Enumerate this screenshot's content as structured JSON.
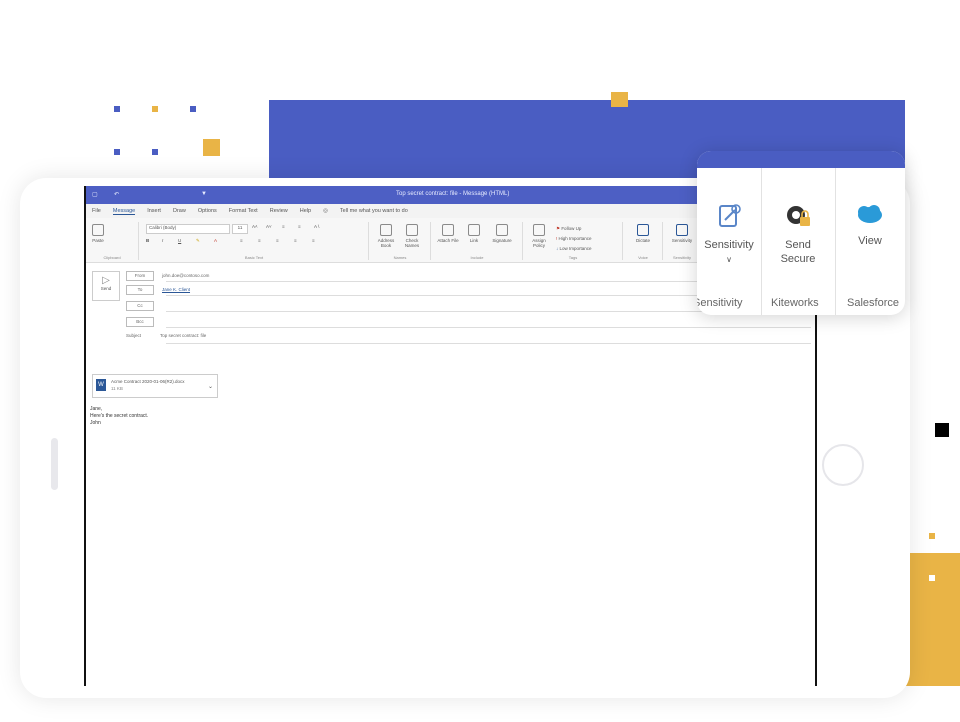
{
  "window": {
    "title": "Top secret contract: file - Message (HTML)",
    "tell_me": "Tell me what you want to do"
  },
  "tabs": [
    "File",
    "Message",
    "Insert",
    "Draw",
    "Options",
    "Format Text",
    "Review",
    "Help"
  ],
  "ribbon": {
    "groups": [
      "Clipboard",
      "Basic Text",
      "Names",
      "Include",
      "Tags",
      "Voice",
      "Sensitivity"
    ],
    "paste_label": "Paste",
    "font_name": "Calibri (Body)",
    "font_size": "11",
    "address_book": "Address Book",
    "check_names": "Check Names",
    "attach_file": "Attach File",
    "link": "Link",
    "signature": "Signature",
    "assign_policy": "Assign Policy",
    "follow_up": "Follow Up",
    "high_importance": "High Importance",
    "low_importance": "Low Importance",
    "dictate": "Dictate",
    "sensitivity": "Sensitivity"
  },
  "compose": {
    "send": "Send",
    "from_label": "From",
    "from_value": "john.doe@contoso.com",
    "to_label": "To",
    "to_value": "Jane K. Client",
    "cc_label": "Cc",
    "bcc_label": "Bcc",
    "subject_label": "Subject",
    "subject_value": "Top secret contract: file"
  },
  "attachment": {
    "name": "Acme Contract 2020-01-06(R2).docx",
    "size": "11 KB",
    "icon": "word-doc-icon"
  },
  "body_lines": [
    "Jane,",
    "Here's the secret contract.",
    "John"
  ],
  "zoom_panel": {
    "buttons": [
      {
        "label": "Sensitivity",
        "sub": "∨",
        "icon": "sensitivity-icon",
        "group": "Sensitivity"
      },
      {
        "label": "Send Secure",
        "sub": "",
        "icon": "send-secure-icon",
        "group": "Kiteworks"
      },
      {
        "label": "View",
        "sub": "",
        "icon": "salesforce-cloud-icon",
        "group": "Salesforce"
      }
    ]
  },
  "colors": {
    "brand_blue": "#4a5dc2",
    "accent_gold": "#e9b446",
    "word_blue": "#2b5797"
  }
}
